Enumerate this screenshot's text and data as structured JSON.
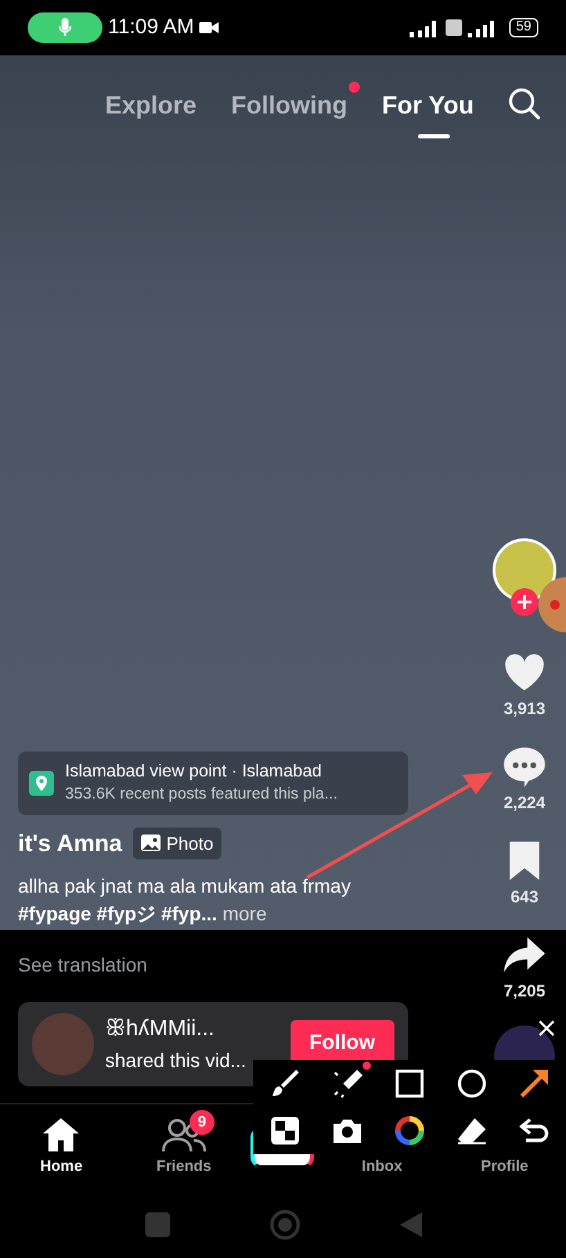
{
  "status_bar": {
    "time": "11:09 AM",
    "battery": "59"
  },
  "top_tabs": [
    {
      "label": "Explore",
      "selected": false,
      "dot": false
    },
    {
      "label": "Following",
      "selected": false,
      "dot": true
    },
    {
      "label": "For You",
      "selected": true,
      "dot": false
    }
  ],
  "location": {
    "name": "Islamabad view point · Islamabad",
    "subtitle": "353.6K recent posts featured this pla..."
  },
  "author": "it's Amna",
  "post_type": "Photo",
  "caption": "allha pak jnat ma ala mukam ata frmay **#fypage #fypジ #fyp...**",
  "more": "more",
  "see_translation": "See translation",
  "actions": [
    {
      "kind": "like",
      "count": "3,913"
    },
    {
      "kind": "comment",
      "count": "2,224"
    },
    {
      "kind": "bookmark",
      "count": "643"
    },
    {
      "kind": "share",
      "count": "7,205"
    }
  ],
  "share_card": {
    "name": "ꕥhʎMMii...",
    "text": "shared this vid...",
    "button": "Follow"
  },
  "nav": [
    {
      "kind": "home",
      "label": "Home",
      "selected": true
    },
    {
      "kind": "friends",
      "label": "Friends",
      "selected": false,
      "badge": "9"
    },
    {
      "kind": "create"
    },
    {
      "kind": "inbox",
      "label": "Inbox",
      "selected": false
    },
    {
      "kind": "profile",
      "label": "Profile",
      "selected": false
    }
  ],
  "draw_tools": [
    {
      "kind": "brush",
      "dot": false
    },
    {
      "kind": "marker",
      "dot": true
    },
    {
      "kind": "square",
      "dot": false
    },
    {
      "kind": "circle",
      "dot": false
    },
    {
      "kind": "arrow",
      "dot": false
    },
    {
      "kind": "mosaic",
      "dot": false
    },
    {
      "kind": "camera",
      "dot": false
    },
    {
      "kind": "color",
      "dot": false
    },
    {
      "kind": "eraser",
      "dot": false
    },
    {
      "kind": "undo",
      "dot": false
    }
  ]
}
